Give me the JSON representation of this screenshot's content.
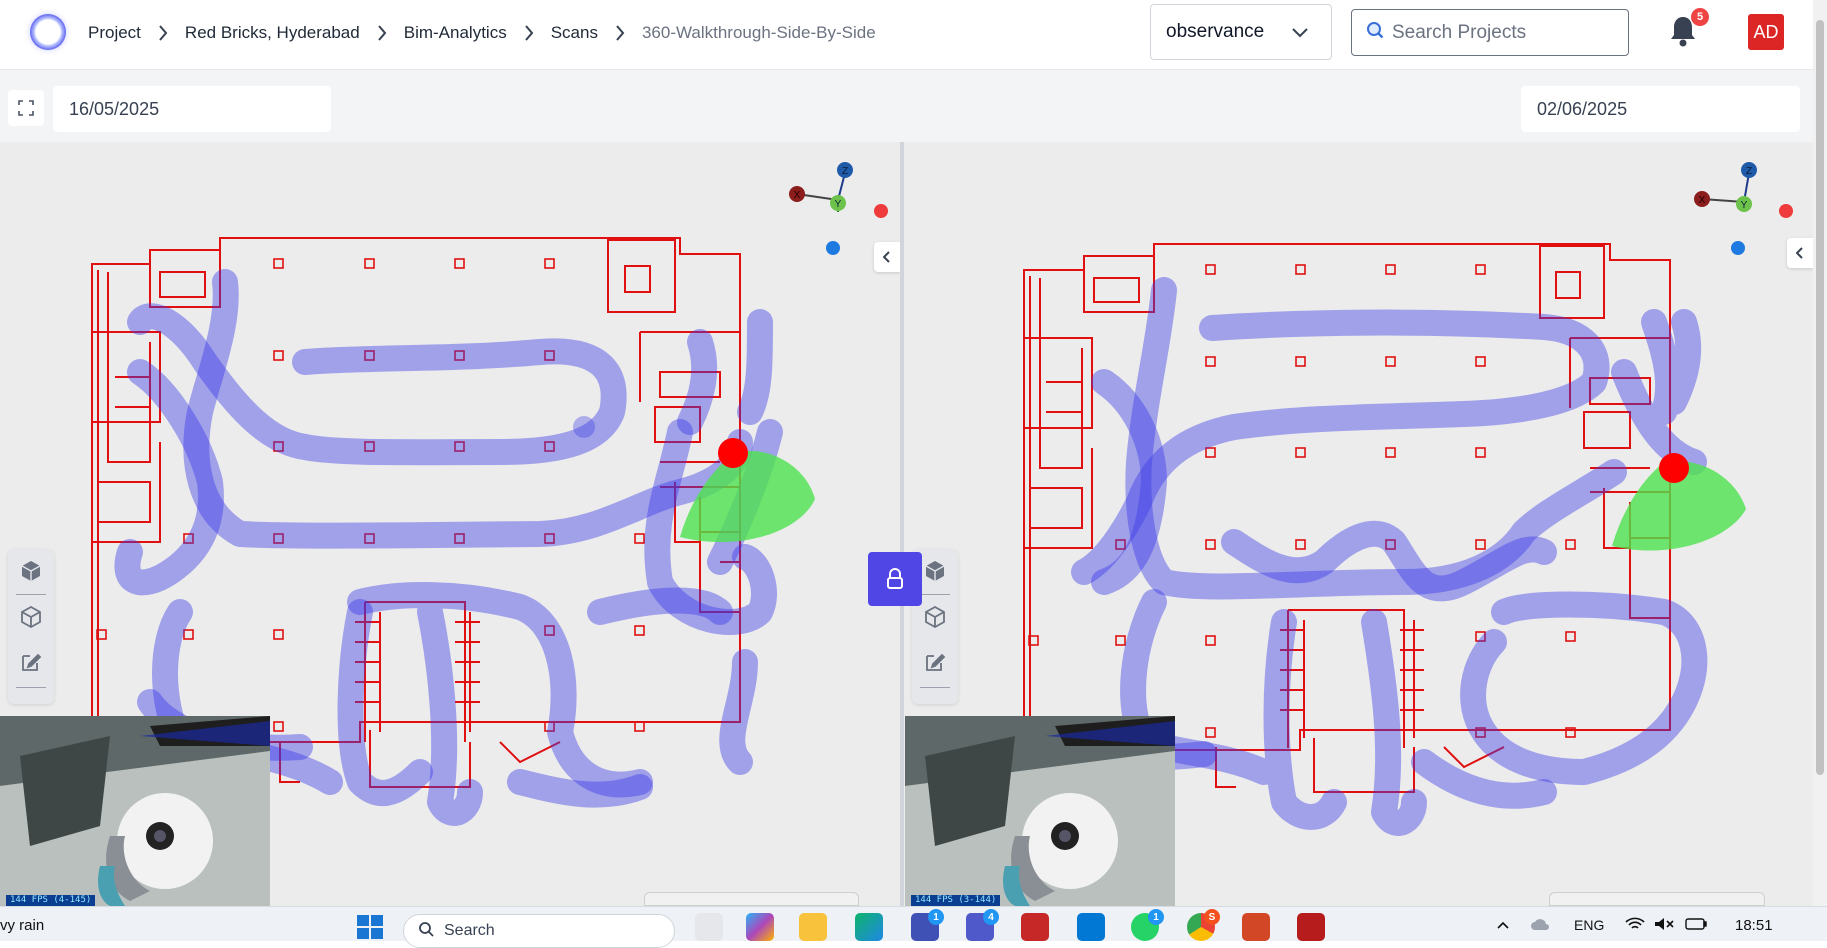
{
  "header": {
    "breadcrumb": [
      "Project",
      "Red Bricks, Hyderabad",
      "Bim-Analytics",
      "Scans",
      "360-Walkthrough-Side-By-Side"
    ],
    "dropdown_value": "observance",
    "search_placeholder": "Search Projects",
    "notification_count": "5",
    "avatar_initials": "AD"
  },
  "comparison": {
    "left_date": "16/05/2025",
    "right_date": "02/06/2025",
    "left_fps": "144 FPS (4-145)",
    "right_fps": "144 FPS (3-144)",
    "axis_labels": {
      "x": "X",
      "y": "Y",
      "z": "Z"
    }
  },
  "taskbar": {
    "weather": "vy rain",
    "search_label": "Search",
    "language": "ENG",
    "time": "18:51",
    "badges": {
      "store": "1",
      "teams": "4",
      "whatsapp": "1",
      "chrome": "S"
    }
  },
  "colors": {
    "accent": "#4f46e5",
    "walls": "#e01010",
    "path": "#3a3ae6",
    "fov": "#4ee24e",
    "marker": "#ff0000"
  },
  "icons": [
    "expand-icon",
    "chevron-down-icon",
    "search-icon",
    "bell-icon",
    "cube-icon",
    "cube-outline-icon",
    "edit-icon",
    "chevron-left-icon",
    "lock-icon",
    "windows-icon"
  ]
}
